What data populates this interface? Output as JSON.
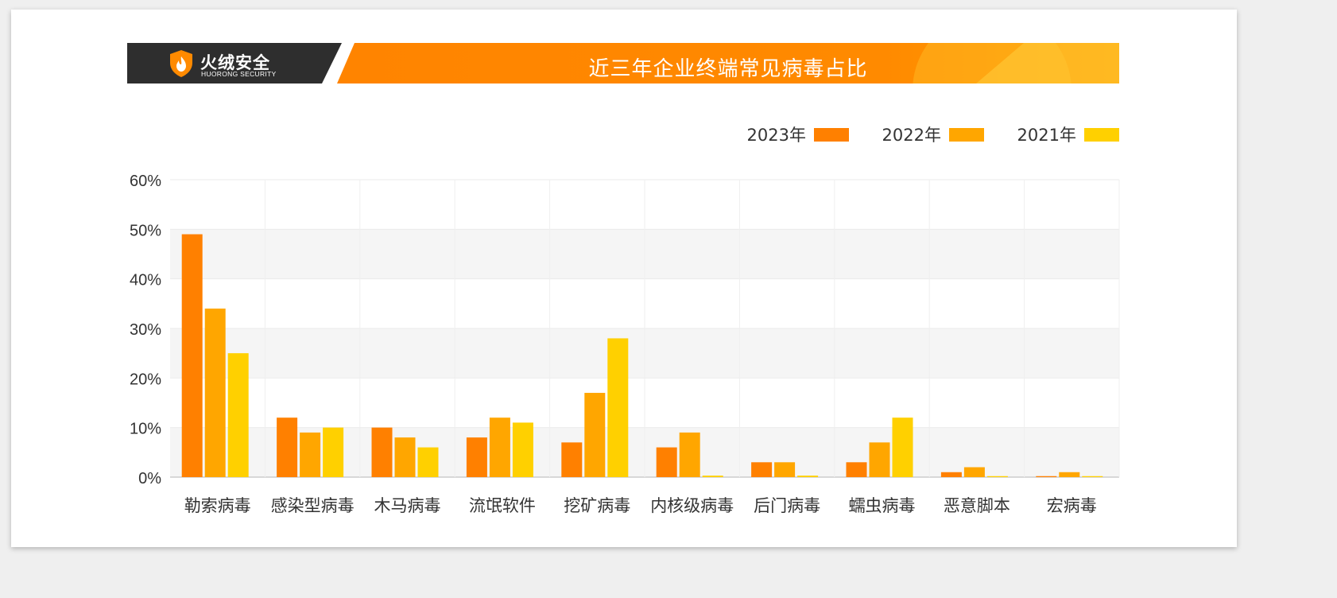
{
  "brand": {
    "name_cn": "火绒安全",
    "name_en": "HUORONG SECURITY"
  },
  "title": "近三年企业终端常见病毒占比",
  "colors": {
    "s2023": "#ff8000",
    "s2022": "#ffa600",
    "s2021": "#ffd000",
    "axis_text": "#333333",
    "title_bar": "#ff8400",
    "logo_bg": "#2e2e2e"
  },
  "chart_data": {
    "type": "bar",
    "title": "近三年企业终端常见病毒占比",
    "xlabel": "",
    "ylabel": "",
    "ylim": [
      0,
      60
    ],
    "yticks": [
      "0%",
      "10%",
      "20%",
      "30%",
      "40%",
      "50%",
      "60%"
    ],
    "grid": true,
    "legend_position": "top-right",
    "categories": [
      "勒索病毒",
      "感染型病毒",
      "木马病毒",
      "流氓软件",
      "挖矿病毒",
      "内核级病毒",
      "后门病毒",
      "蠕虫病毒",
      "恶意脚本",
      "宏病毒"
    ],
    "series": [
      {
        "name": "2023年",
        "color": "#ff8000",
        "values": [
          49,
          12,
          10,
          8,
          7,
          6,
          3,
          3,
          1,
          0.2
        ]
      },
      {
        "name": "2022年",
        "color": "#ffa600",
        "values": [
          34,
          9,
          8,
          12,
          17,
          9,
          3,
          7,
          2,
          1
        ]
      },
      {
        "name": "2021年",
        "color": "#ffd000",
        "values": [
          25,
          10,
          6,
          11,
          28,
          0.3,
          0.3,
          12,
          0.2,
          0.2
        ]
      }
    ]
  }
}
